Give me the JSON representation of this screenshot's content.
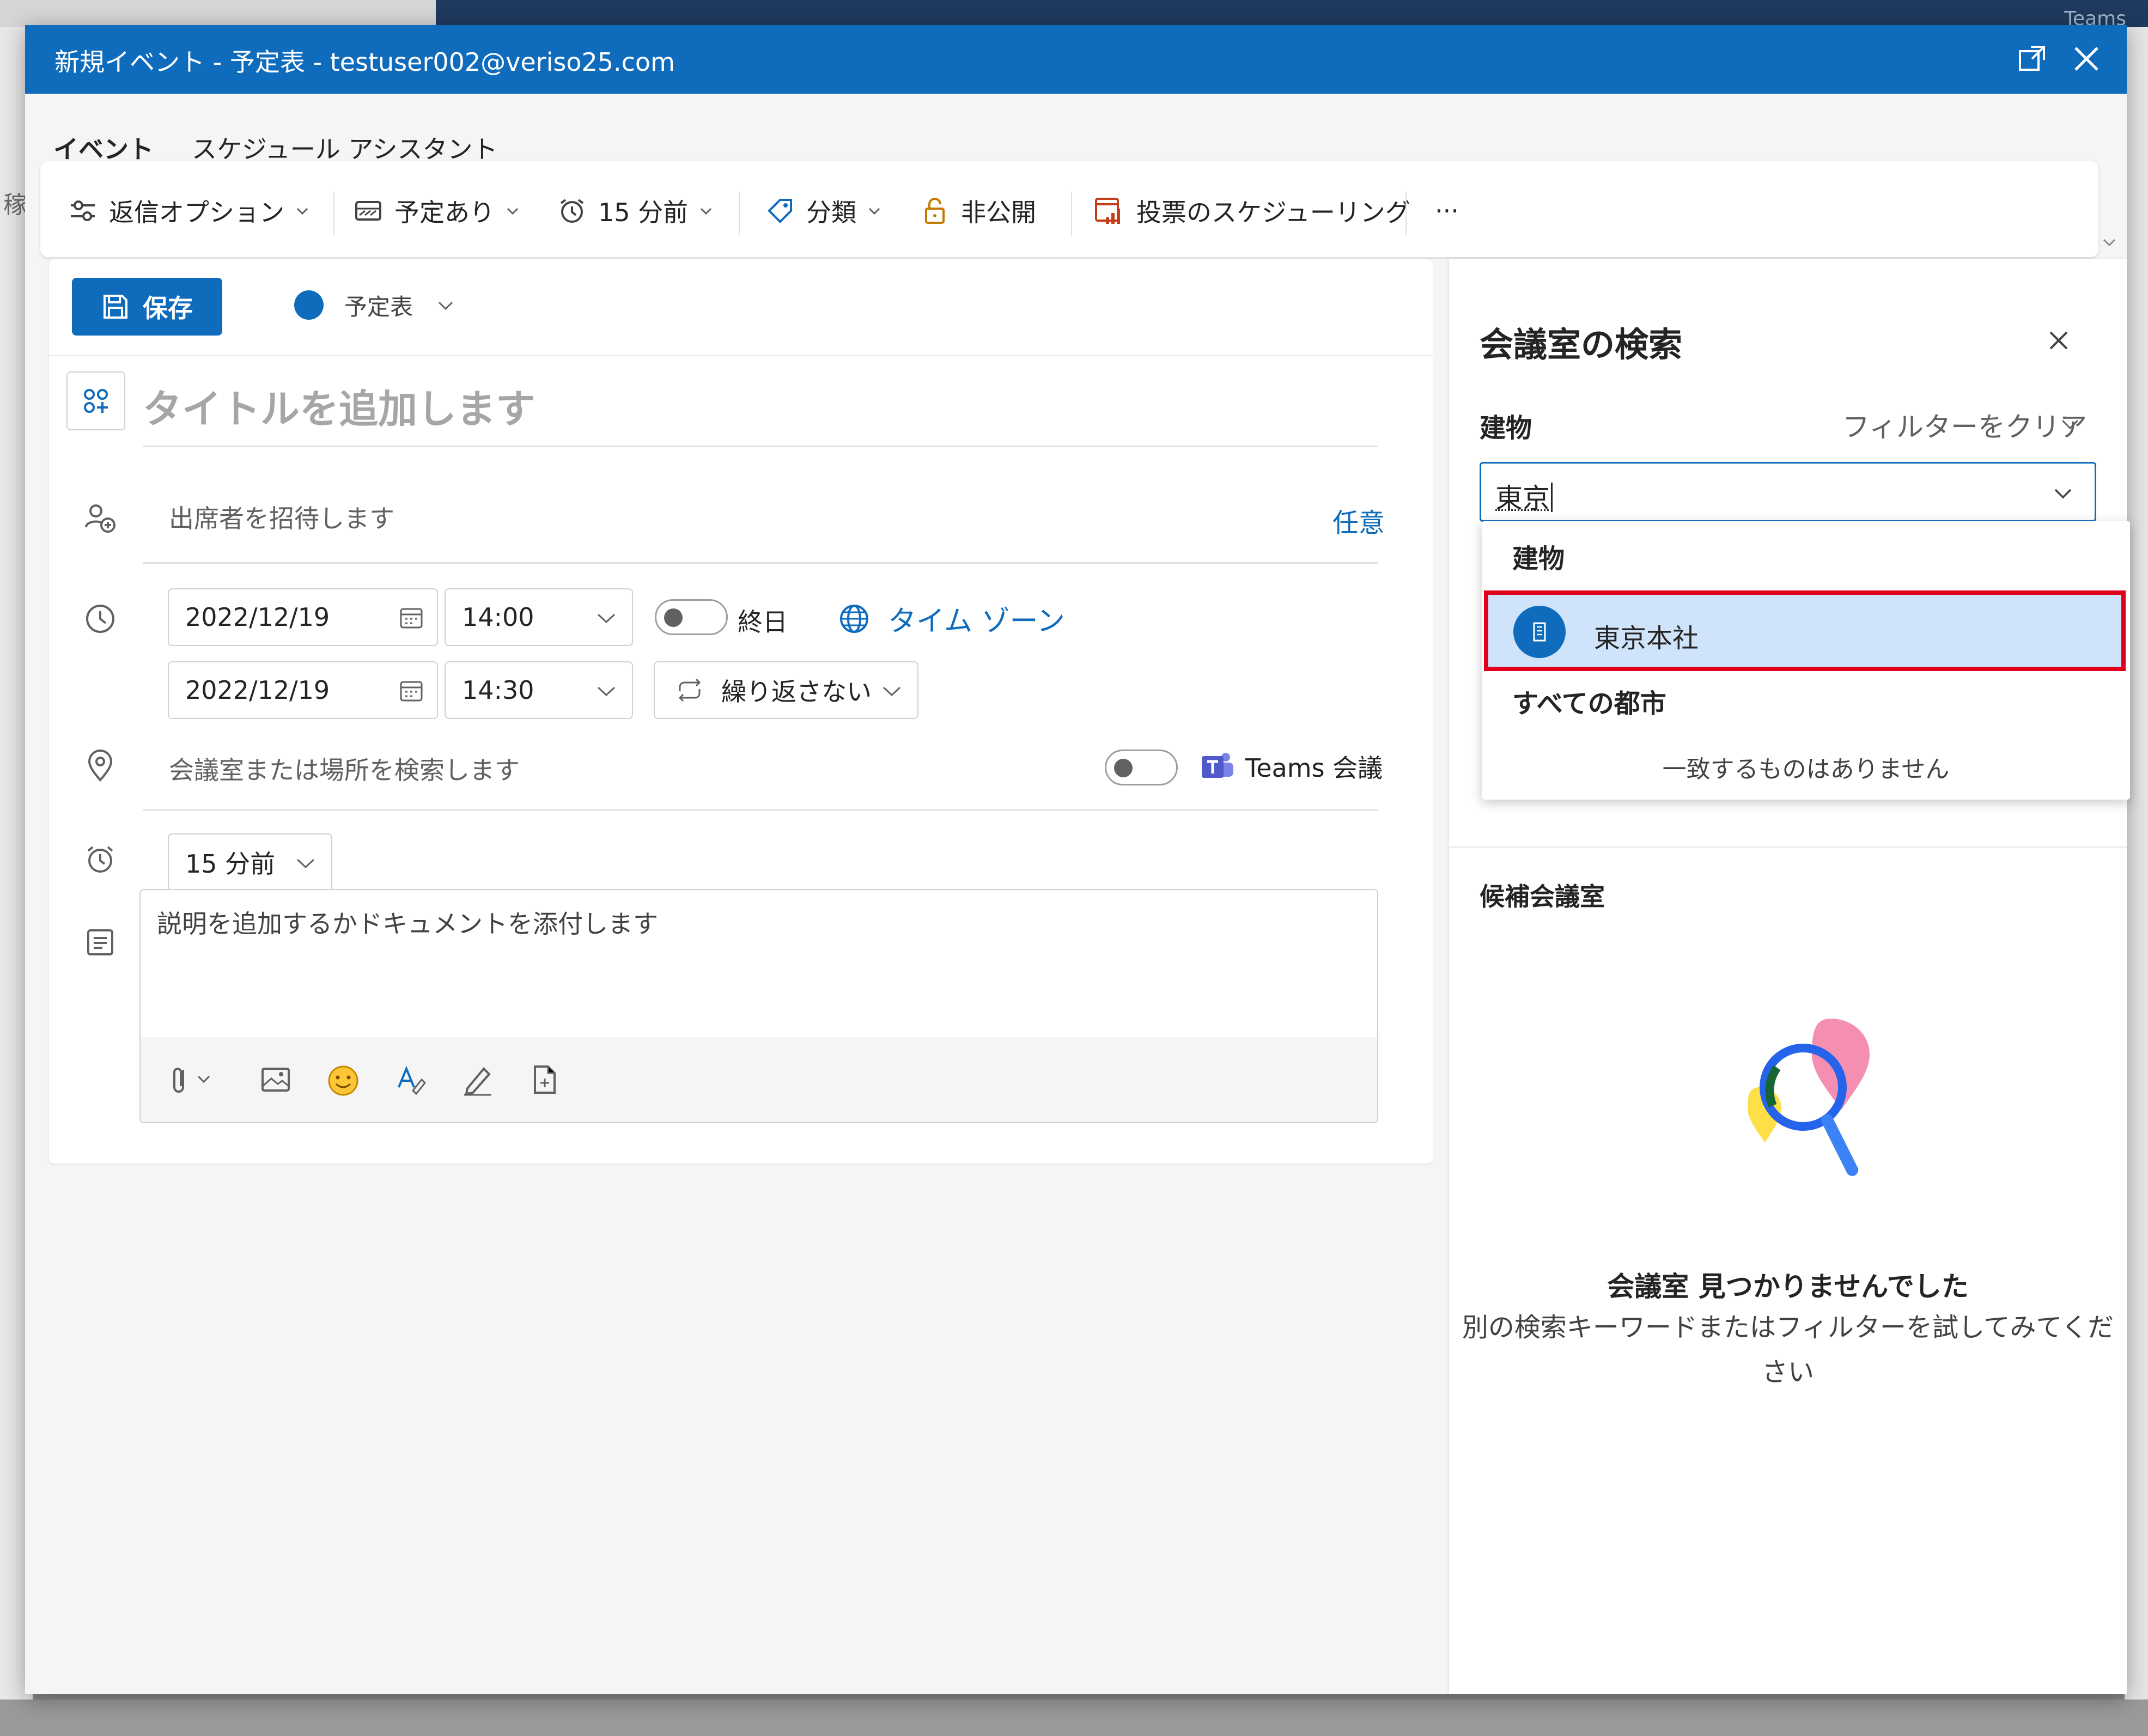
{
  "background": {
    "teams_label": "Teams",
    "left_char": "稼"
  },
  "window": {
    "title": "新規イベント - 予定表 - testuser002@veriso25.com"
  },
  "tabs": [
    {
      "label": "イベント",
      "active": true
    },
    {
      "label": "スケジュール アシスタント",
      "active": false
    }
  ],
  "toolbar": {
    "response_options": "返信オプション",
    "show_as": "予定あり",
    "reminder": "15 分前",
    "category": "分類",
    "private": "非公開",
    "poll": "投票のスケジューリング",
    "more": "···"
  },
  "form": {
    "save_label": "保存",
    "calendar_name": "予定表",
    "title_placeholder": "タイトルを追加します",
    "attendees_placeholder": "出席者を招待します",
    "optional_link": "任意",
    "start_date": "2022/12/19",
    "start_time": "14:00",
    "end_date": "2022/12/19",
    "end_time": "14:30",
    "all_day_label": "終日",
    "timezone_link": "タイム ゾーン",
    "repeat_label": "繰り返さない",
    "location_placeholder": "会議室または場所を検索します",
    "teams_meeting_label": "Teams 会議",
    "reminder_value": "15 分前",
    "description_placeholder": "説明を追加するかドキュメントを添付します"
  },
  "room_finder": {
    "title": "会議室の検索",
    "building_label": "建物",
    "clear_filter": "フィルターをクリア",
    "building_input_value": "東京",
    "dropdown": {
      "header": "建物",
      "selected_item": "東京本社",
      "cities_header": "すべての都市",
      "no_match": "一致するものはありません"
    },
    "candidates_label": "候補会議室",
    "empty_title": "会議室 見つかりませんでした",
    "empty_desc_line1": "別の検索キーワードまたはフィルターを試してみてくだ",
    "empty_desc_line2": "さい"
  },
  "colors": {
    "accent": "#0f6cbd",
    "highlight_border": "#e0001b",
    "selected_bg": "#cfe4fa"
  }
}
